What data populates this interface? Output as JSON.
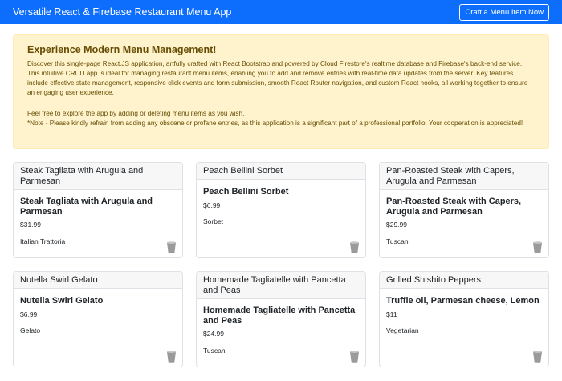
{
  "navbar": {
    "brand": "Versatile React & Firebase Restaurant Menu App",
    "cta_label": "Craft a Menu Item Now",
    "color": "#0d6efd"
  },
  "alert": {
    "heading": "Experience Modern Menu Management!",
    "paragraph": "Discover this single-page React.JS application, artfully crafted with React Bootstrap and powered by Cloud Firestore's realtime database and Firebase's back-end service. This intuitive CRUD app is ideal for managing restaurant menu items, enabling you to add and remove entries with real-time data updates from the server. Key features include effective state management, responsive click events and form submission, smooth React Router navigation, and custom React hooks, all working together to ensure an engaging user experience.",
    "invite": "Feel free to explore the app by adding or deleting menu items as you wish.",
    "note": "*Note - Please kindly refrain from adding any obscene or profane entries, as this application is a significant part of a professional portfolio. Your cooperation is appreciated!"
  },
  "menu_items": [
    {
      "header": "Steak Tagliata with Arugula and Parmesan",
      "title": "Steak Tagliata with Arugula and Parmesan",
      "price": "$31.99",
      "category": "Italian Trattoria"
    },
    {
      "header": "Peach Bellini Sorbet",
      "title": "Peach Bellini Sorbet",
      "price": "$6.99",
      "category": "Sorbet"
    },
    {
      "header": "Pan-Roasted Steak with Capers, Arugula and Parmesan",
      "title": "Pan-Roasted Steak with Capers, Arugula and Parmesan",
      "price": "$29.99",
      "category": "Tuscan"
    },
    {
      "header": "Nutella Swirl Gelato",
      "title": "Nutella Swirl Gelato",
      "price": "$6.99",
      "category": "Gelato"
    },
    {
      "header": "Homemade Tagliatelle with Pancetta and Peas",
      "title": "Homemade Tagliatelle with Pancetta and Peas",
      "price": "$24.99",
      "category": "Tuscan"
    },
    {
      "header": "Grilled Shishito Peppers",
      "title": "Truffle oil, Parmesan cheese, Lemon",
      "price": "$11",
      "category": "Vegetarian"
    }
  ],
  "icons": {
    "delete": "trash-icon"
  }
}
